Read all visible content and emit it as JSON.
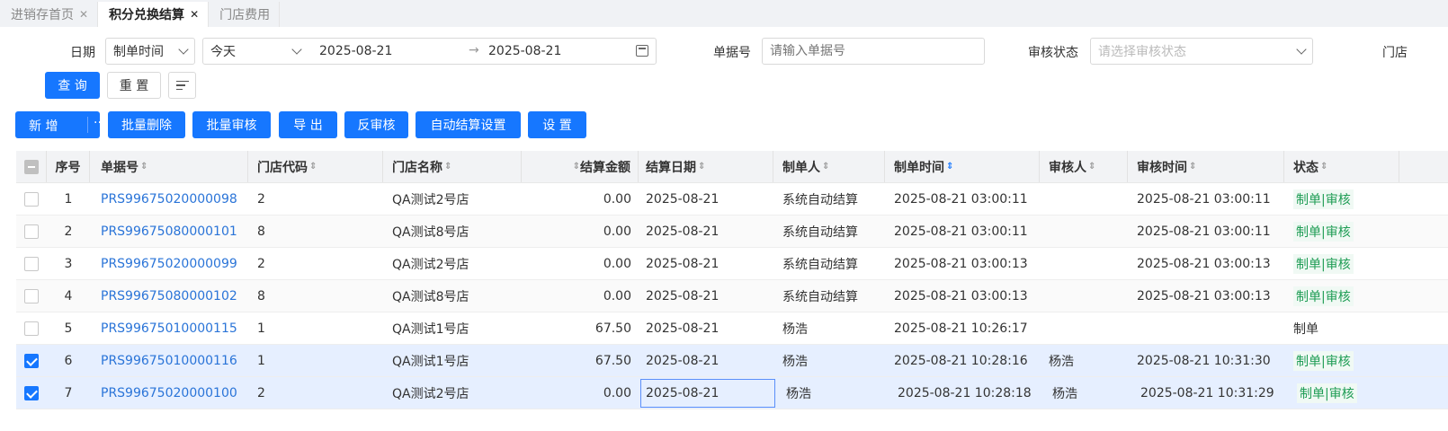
{
  "tabs": [
    {
      "label": "进销存首页",
      "active": false
    },
    {
      "label": "积分兑换结算",
      "active": true
    },
    {
      "label": "门店费用",
      "active": false
    }
  ],
  "tab_close": "✕",
  "filters": {
    "date_label": "日期",
    "date_type": "制单时间",
    "date_range": "今天",
    "date_from": "2025-08-21",
    "date_arrow": "→",
    "date_to": "2025-08-21",
    "doc_no_label": "单据号",
    "doc_no_placeholder": "请输入单据号",
    "audit_status_label": "审核状态",
    "audit_status_placeholder": "请选择审核状态",
    "store_label": "门店"
  },
  "query_buttons": {
    "query": "查 询",
    "reset": "重 置"
  },
  "toolbar": {
    "add": "新 增",
    "more": "···",
    "batch_delete": "批量删除",
    "batch_audit": "批量审核",
    "export": "导 出",
    "unaudit": "反审核",
    "auto_settle": "自动结算设置",
    "settings": "设 置"
  },
  "sort_icon": "⇕",
  "table": {
    "headers": {
      "seq": "序号",
      "doc_no": "单据号",
      "store_code": "门店代码",
      "store_name": "门店名称",
      "amount": "结算金额",
      "settle_date": "结算日期",
      "maker": "制单人",
      "make_time": "制单时间",
      "auditor": "审核人",
      "audit_time": "审核时间",
      "status": "状态"
    },
    "rows": [
      {
        "seq": "1",
        "doc_no": "PRS99675020000098",
        "store_code": "2",
        "store_name": "QA测试2号店",
        "amount": "0.00",
        "settle_date": "2025-08-21",
        "maker": "系统自动结算",
        "make_time": "2025-08-21 03:00:11",
        "auditor": "",
        "audit_time": "2025-08-21 03:00:11",
        "status": "制单|审核",
        "checked": false
      },
      {
        "seq": "2",
        "doc_no": "PRS99675080000101",
        "store_code": "8",
        "store_name": "QA测试8号店",
        "amount": "0.00",
        "settle_date": "2025-08-21",
        "maker": "系统自动结算",
        "make_time": "2025-08-21 03:00:11",
        "auditor": "",
        "audit_time": "2025-08-21 03:00:11",
        "status": "制单|审核",
        "checked": false
      },
      {
        "seq": "3",
        "doc_no": "PRS99675020000099",
        "store_code": "2",
        "store_name": "QA测试2号店",
        "amount": "0.00",
        "settle_date": "2025-08-21",
        "maker": "系统自动结算",
        "make_time": "2025-08-21 03:00:13",
        "auditor": "",
        "audit_time": "2025-08-21 03:00:13",
        "status": "制单|审核",
        "checked": false
      },
      {
        "seq": "4",
        "doc_no": "PRS99675080000102",
        "store_code": "8",
        "store_name": "QA测试8号店",
        "amount": "0.00",
        "settle_date": "2025-08-21",
        "maker": "系统自动结算",
        "make_time": "2025-08-21 03:00:13",
        "auditor": "",
        "audit_time": "2025-08-21 03:00:13",
        "status": "制单|审核",
        "checked": false
      },
      {
        "seq": "5",
        "doc_no": "PRS99675010000115",
        "store_code": "1",
        "store_name": "QA测试1号店",
        "amount": "67.50",
        "settle_date": "2025-08-21",
        "maker": "杨浩",
        "make_time": "2025-08-21 10:26:17",
        "auditor": "",
        "audit_time": "",
        "status": "制单",
        "checked": false
      },
      {
        "seq": "6",
        "doc_no": "PRS99675010000116",
        "store_code": "1",
        "store_name": "QA测试1号店",
        "amount": "67.50",
        "settle_date": "2025-08-21",
        "maker": "杨浩",
        "make_time": "2025-08-21 10:28:16",
        "auditor": "杨浩",
        "audit_time": "2025-08-21 10:31:30",
        "status": "制单|审核",
        "checked": true
      },
      {
        "seq": "7",
        "doc_no": "PRS99675020000100",
        "store_code": "2",
        "store_name": "QA测试2号店",
        "amount": "0.00",
        "settle_date": "2025-08-21",
        "maker": "杨浩",
        "make_time": "2025-08-21 10:28:18",
        "auditor": "杨浩",
        "audit_time": "2025-08-21 10:31:29",
        "status": "制单|审核",
        "checked": true
      }
    ]
  }
}
